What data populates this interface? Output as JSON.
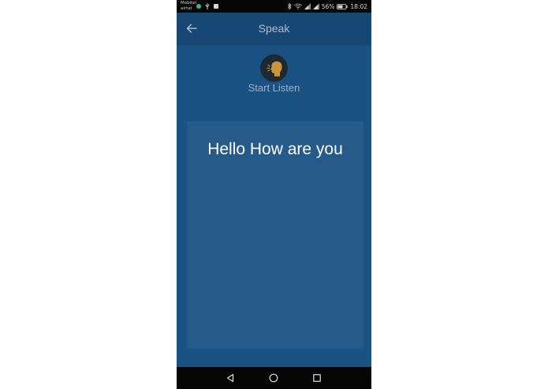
{
  "status_bar": {
    "carrier_line1": "Mobitel",
    "carrier_line2": "airtel",
    "battery": "56%",
    "time": "18:02"
  },
  "app_bar": {
    "title": "Speak",
    "back_icon": "arrow-left-icon"
  },
  "speak": {
    "icon": "speaking-head-icon",
    "button_label": "Start Listen"
  },
  "transcript": {
    "text": "Hello How are you"
  },
  "nav": {
    "back_icon": "triangle-back-icon",
    "home_icon": "circle-home-icon",
    "recents_icon": "square-recents-icon"
  },
  "colors": {
    "background": "#1a5283",
    "app_bar": "#174875",
    "card": "#255a89",
    "icon_accent": "#c9973a"
  }
}
